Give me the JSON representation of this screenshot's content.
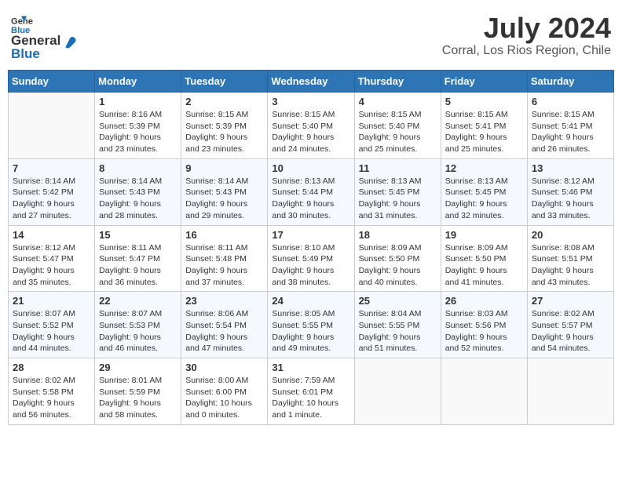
{
  "header": {
    "logo_line1": "General",
    "logo_line2": "Blue",
    "month": "July 2024",
    "location": "Corral, Los Rios Region, Chile"
  },
  "days_of_week": [
    "Sunday",
    "Monday",
    "Tuesday",
    "Wednesday",
    "Thursday",
    "Friday",
    "Saturday"
  ],
  "weeks": [
    [
      {
        "day": "",
        "info": ""
      },
      {
        "day": "1",
        "info": "Sunrise: 8:16 AM\nSunset: 5:39 PM\nDaylight: 9 hours\nand 23 minutes."
      },
      {
        "day": "2",
        "info": "Sunrise: 8:15 AM\nSunset: 5:39 PM\nDaylight: 9 hours\nand 23 minutes."
      },
      {
        "day": "3",
        "info": "Sunrise: 8:15 AM\nSunset: 5:40 PM\nDaylight: 9 hours\nand 24 minutes."
      },
      {
        "day": "4",
        "info": "Sunrise: 8:15 AM\nSunset: 5:40 PM\nDaylight: 9 hours\nand 25 minutes."
      },
      {
        "day": "5",
        "info": "Sunrise: 8:15 AM\nSunset: 5:41 PM\nDaylight: 9 hours\nand 25 minutes."
      },
      {
        "day": "6",
        "info": "Sunrise: 8:15 AM\nSunset: 5:41 PM\nDaylight: 9 hours\nand 26 minutes."
      }
    ],
    [
      {
        "day": "7",
        "info": "Sunrise: 8:14 AM\nSunset: 5:42 PM\nDaylight: 9 hours\nand 27 minutes."
      },
      {
        "day": "8",
        "info": "Sunrise: 8:14 AM\nSunset: 5:43 PM\nDaylight: 9 hours\nand 28 minutes."
      },
      {
        "day": "9",
        "info": "Sunrise: 8:14 AM\nSunset: 5:43 PM\nDaylight: 9 hours\nand 29 minutes."
      },
      {
        "day": "10",
        "info": "Sunrise: 8:13 AM\nSunset: 5:44 PM\nDaylight: 9 hours\nand 30 minutes."
      },
      {
        "day": "11",
        "info": "Sunrise: 8:13 AM\nSunset: 5:45 PM\nDaylight: 9 hours\nand 31 minutes."
      },
      {
        "day": "12",
        "info": "Sunrise: 8:13 AM\nSunset: 5:45 PM\nDaylight: 9 hours\nand 32 minutes."
      },
      {
        "day": "13",
        "info": "Sunrise: 8:12 AM\nSunset: 5:46 PM\nDaylight: 9 hours\nand 33 minutes."
      }
    ],
    [
      {
        "day": "14",
        "info": "Sunrise: 8:12 AM\nSunset: 5:47 PM\nDaylight: 9 hours\nand 35 minutes."
      },
      {
        "day": "15",
        "info": "Sunrise: 8:11 AM\nSunset: 5:47 PM\nDaylight: 9 hours\nand 36 minutes."
      },
      {
        "day": "16",
        "info": "Sunrise: 8:11 AM\nSunset: 5:48 PM\nDaylight: 9 hours\nand 37 minutes."
      },
      {
        "day": "17",
        "info": "Sunrise: 8:10 AM\nSunset: 5:49 PM\nDaylight: 9 hours\nand 38 minutes."
      },
      {
        "day": "18",
        "info": "Sunrise: 8:09 AM\nSunset: 5:50 PM\nDaylight: 9 hours\nand 40 minutes."
      },
      {
        "day": "19",
        "info": "Sunrise: 8:09 AM\nSunset: 5:50 PM\nDaylight: 9 hours\nand 41 minutes."
      },
      {
        "day": "20",
        "info": "Sunrise: 8:08 AM\nSunset: 5:51 PM\nDaylight: 9 hours\nand 43 minutes."
      }
    ],
    [
      {
        "day": "21",
        "info": "Sunrise: 8:07 AM\nSunset: 5:52 PM\nDaylight: 9 hours\nand 44 minutes."
      },
      {
        "day": "22",
        "info": "Sunrise: 8:07 AM\nSunset: 5:53 PM\nDaylight: 9 hours\nand 46 minutes."
      },
      {
        "day": "23",
        "info": "Sunrise: 8:06 AM\nSunset: 5:54 PM\nDaylight: 9 hours\nand 47 minutes."
      },
      {
        "day": "24",
        "info": "Sunrise: 8:05 AM\nSunset: 5:55 PM\nDaylight: 9 hours\nand 49 minutes."
      },
      {
        "day": "25",
        "info": "Sunrise: 8:04 AM\nSunset: 5:55 PM\nDaylight: 9 hours\nand 51 minutes."
      },
      {
        "day": "26",
        "info": "Sunrise: 8:03 AM\nSunset: 5:56 PM\nDaylight: 9 hours\nand 52 minutes."
      },
      {
        "day": "27",
        "info": "Sunrise: 8:02 AM\nSunset: 5:57 PM\nDaylight: 9 hours\nand 54 minutes."
      }
    ],
    [
      {
        "day": "28",
        "info": "Sunrise: 8:02 AM\nSunset: 5:58 PM\nDaylight: 9 hours\nand 56 minutes."
      },
      {
        "day": "29",
        "info": "Sunrise: 8:01 AM\nSunset: 5:59 PM\nDaylight: 9 hours\nand 58 minutes."
      },
      {
        "day": "30",
        "info": "Sunrise: 8:00 AM\nSunset: 6:00 PM\nDaylight: 10 hours\nand 0 minutes."
      },
      {
        "day": "31",
        "info": "Sunrise: 7:59 AM\nSunset: 6:01 PM\nDaylight: 10 hours\nand 1 minute."
      },
      {
        "day": "",
        "info": ""
      },
      {
        "day": "",
        "info": ""
      },
      {
        "day": "",
        "info": ""
      }
    ]
  ]
}
